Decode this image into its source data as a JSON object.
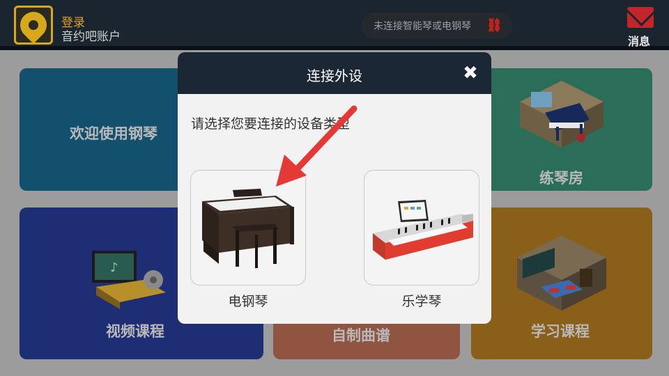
{
  "header": {
    "login_label": "登录",
    "account_label": "音约吧账户",
    "connection_status": "未连接智能琴或电钢琴",
    "message_label": "消息"
  },
  "tiles": {
    "welcome": "欢迎使用钢琴",
    "practice_room": "练琴房",
    "video_courses": "视频课程",
    "custom_score": "自制曲谱",
    "study_courses": "学习课程"
  },
  "modal": {
    "title": "连接外设",
    "prompt": "请选择您要连接的设备类型",
    "options": [
      {
        "label": "电钢琴"
      },
      {
        "label": "乐学琴"
      }
    ]
  },
  "colors": {
    "accent": "#e2a21a",
    "topbar": "#1a2530",
    "arrow": "#e53935",
    "disconnected": "#d9231c"
  }
}
